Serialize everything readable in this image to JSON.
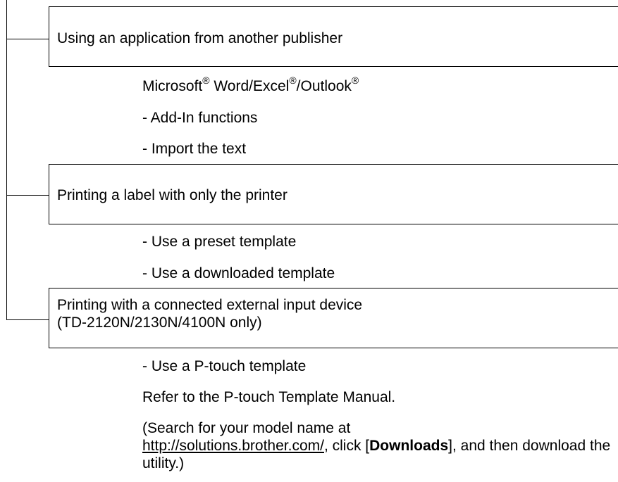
{
  "sections": [
    {
      "title": "Using an application from another publisher",
      "word_item": {
        "microsoft": "Microsoft",
        "reg1": "®",
        "word_excel": " Word/Excel",
        "reg2": "®",
        "outlook": "/Outlook",
        "reg3": "®"
      },
      "items": [
        "- Add-In functions",
        "- Import the text"
      ]
    },
    {
      "title": "Printing a label with only the printer",
      "items": [
        "- Use a preset template",
        "- Use a downloaded template"
      ]
    },
    {
      "title_line1": "Printing with a connected external input device",
      "title_line2": "(TD-2120N/2130N/4100N only)",
      "items": [
        "- Use a P-touch template",
        "Refer to the P-touch Template Manual."
      ]
    }
  ],
  "note": {
    "prefix": "(Search for your model name at",
    "url": "http://solutions.brother.com/",
    "mid": ", click [",
    "downloads": "Downloads",
    "suffix": "], and then download the utility.)"
  }
}
